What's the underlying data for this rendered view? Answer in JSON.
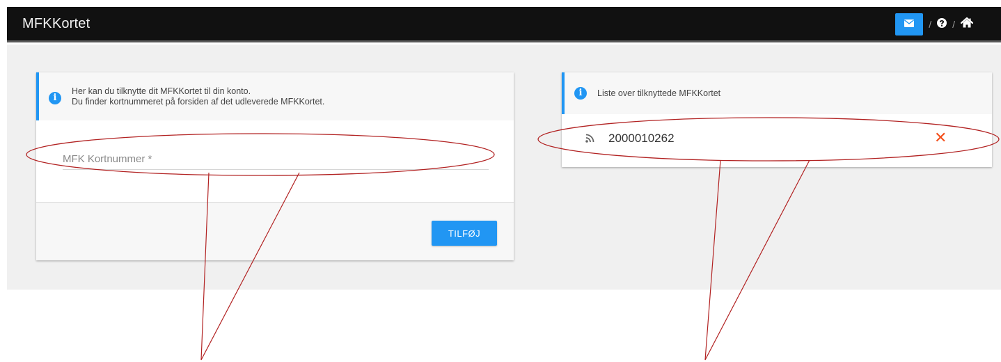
{
  "header": {
    "title": "MFKKortet",
    "separator_1": "/",
    "separator_2": "/",
    "icons": {
      "mail": "envelope-icon",
      "help": "question-circle-icon",
      "home": "home-icon"
    }
  },
  "add_card_panel": {
    "info_line_1": "Her kan du tilknytte dit MFKKortet til din konto.",
    "info_line_2": "Du finder kortnummeret på forsiden af det udleverede MFKKortet.",
    "input_placeholder": "MFK Kortnummer *",
    "input_value": "",
    "add_button_label": "TILFØJ"
  },
  "linked_cards_panel": {
    "info_text": "Liste over tilknyttede MFKKortet",
    "cards": [
      {
        "number": "2000010262"
      }
    ]
  },
  "colors": {
    "accent": "#2196f3",
    "topbar": "#111111",
    "remove": "#f4511e",
    "annotation": "#b22222"
  }
}
